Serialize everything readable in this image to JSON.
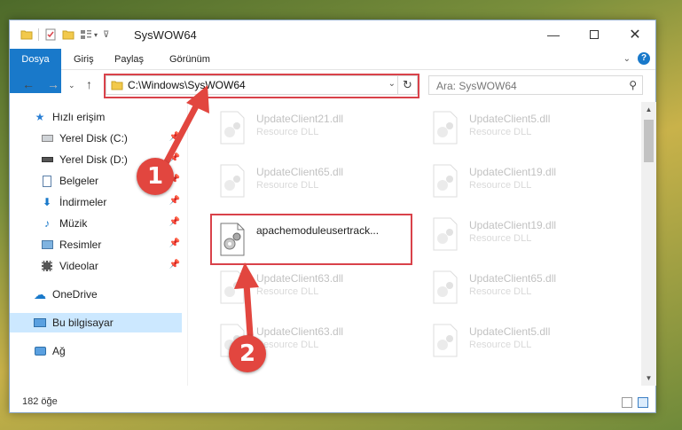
{
  "window": {
    "title": "SysWOW64"
  },
  "ribbon": {
    "tabs": [
      "Dosya",
      "Giriş",
      "Paylaş",
      "Görünüm"
    ]
  },
  "nav": {
    "address": "C:\\Windows\\SysWOW64",
    "search_placeholder": "Ara: SysWOW64"
  },
  "sidebar": {
    "items": [
      {
        "label": "Hızlı erişim",
        "icon": "star-icon"
      },
      {
        "label": "Yerel Disk (C:)",
        "icon": "drive-icon"
      },
      {
        "label": "Yerel Disk (D:)",
        "icon": "drive-icon"
      },
      {
        "label": "Belgeler",
        "icon": "document-icon"
      },
      {
        "label": "İndirmeler",
        "icon": "download-icon"
      },
      {
        "label": "Müzik",
        "icon": "music-icon"
      },
      {
        "label": "Resimler",
        "icon": "pictures-icon"
      },
      {
        "label": "Videolar",
        "icon": "videos-icon"
      },
      {
        "label": "OneDrive",
        "icon": "cloud-icon"
      },
      {
        "label": "Bu bilgisayar",
        "icon": "computer-icon"
      },
      {
        "label": "Ağ",
        "icon": "network-icon"
      }
    ]
  },
  "files": [
    {
      "name": "UpdateClient21.dll",
      "type": "Resource DLL"
    },
    {
      "name": "UpdateClient5.dll",
      "type": "Resource DLL"
    },
    {
      "name": "UpdateClient65.dll",
      "type": "Resource DLL"
    },
    {
      "name": "UpdateClient19.dll",
      "type": "Resource DLL"
    },
    {
      "name": "apachemoduleusertrack...",
      "type": ""
    },
    {
      "name": "UpdateClient19.dll",
      "type": "Resource DLL"
    },
    {
      "name": "UpdateClient63.dll",
      "type": "Resource DLL"
    },
    {
      "name": "UpdateClient65.dll",
      "type": "Resource DLL"
    },
    {
      "name": "UpdateClient63.dll",
      "type": "Resource DLL"
    },
    {
      "name": "UpdateClient5.dll",
      "type": "Resource DLL"
    }
  ],
  "status": {
    "count": "182 öğe"
  },
  "callouts": {
    "one": "1",
    "two": "2"
  },
  "colors": {
    "accent": "#1979ca",
    "highlight": "#d9424a"
  }
}
